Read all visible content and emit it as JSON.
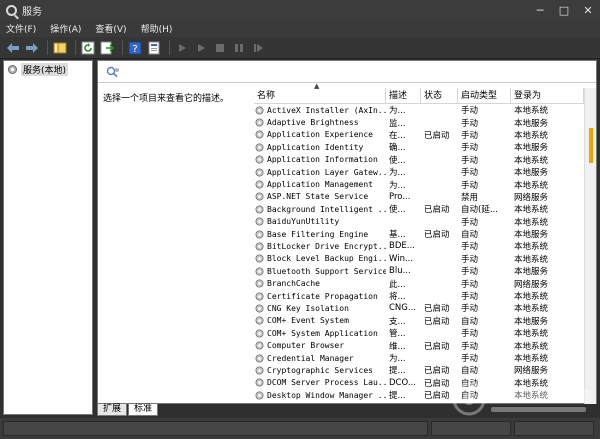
{
  "window": {
    "title": "服务",
    "minimize": "─",
    "maximize": "□",
    "close": "✕"
  },
  "menu": [
    "文件(F)",
    "操作(A)",
    "查看(V)",
    "帮助(H)"
  ],
  "tree": {
    "root_label": "服务(本地)"
  },
  "pane": {
    "description_prompt": "选择一个项目来查看它的描述。"
  },
  "columns": {
    "name": "名称",
    "desc": "描述",
    "status": "状态",
    "start": "启动类型",
    "logon": "登录为"
  },
  "services": [
    {
      "name": "ActiveX Installer (AxIn...",
      "desc": "为...",
      "status": "",
      "start": "手动",
      "logon": "本地系统"
    },
    {
      "name": "Adaptive Brightness",
      "desc": "监...",
      "status": "",
      "start": "手动",
      "logon": "本地服务"
    },
    {
      "name": "Application Experience",
      "desc": "在...",
      "status": "已启动",
      "start": "手动",
      "logon": "本地系统"
    },
    {
      "name": "Application Identity",
      "desc": "确...",
      "status": "",
      "start": "手动",
      "logon": "本地服务"
    },
    {
      "name": "Application Information",
      "desc": "使...",
      "status": "",
      "start": "手动",
      "logon": "本地系统"
    },
    {
      "name": "Application Layer Gatew...",
      "desc": "为...",
      "status": "",
      "start": "手动",
      "logon": "本地服务"
    },
    {
      "name": "Application Management",
      "desc": "为...",
      "status": "",
      "start": "手动",
      "logon": "本地系统"
    },
    {
      "name": "ASP.NET State Service",
      "desc": "Pro...",
      "status": "",
      "start": "禁用",
      "logon": "网络服务"
    },
    {
      "name": "Background Intelligent ...",
      "desc": "使...",
      "status": "已启动",
      "start": "自动(延...",
      "logon": "本地系统"
    },
    {
      "name": "BaiduYunUtility",
      "desc": "",
      "status": "",
      "start": "手动",
      "logon": "本地系统"
    },
    {
      "name": "Base Filtering Engine",
      "desc": "基...",
      "status": "已启动",
      "start": "自动",
      "logon": "本地服务"
    },
    {
      "name": "BitLocker Drive Encrypt...",
      "desc": "BDE...",
      "status": "",
      "start": "手动",
      "logon": "本地系统"
    },
    {
      "name": "Block Level Backup Engi...",
      "desc": "Win...",
      "status": "",
      "start": "手动",
      "logon": "本地系统"
    },
    {
      "name": "Bluetooth Support Service",
      "desc": "Blu...",
      "status": "",
      "start": "手动",
      "logon": "本地服务"
    },
    {
      "name": "BranchCache",
      "desc": "此...",
      "status": "",
      "start": "手动",
      "logon": "网络服务"
    },
    {
      "name": "Certificate Propagation",
      "desc": "将...",
      "status": "",
      "start": "手动",
      "logon": "本地系统"
    },
    {
      "name": "CNG Key Isolation",
      "desc": "CNG...",
      "status": "已启动",
      "start": "手动",
      "logon": "本地系统"
    },
    {
      "name": "COM+ Event System",
      "desc": "支...",
      "status": "已启动",
      "start": "自动",
      "logon": "本地服务"
    },
    {
      "name": "COM+ System Application",
      "desc": "管...",
      "status": "",
      "start": "手动",
      "logon": "本地系统"
    },
    {
      "name": "Computer Browser",
      "desc": "维...",
      "status": "已启动",
      "start": "手动",
      "logon": "本地系统"
    },
    {
      "name": "Credential Manager",
      "desc": "为...",
      "status": "",
      "start": "手动",
      "logon": "本地系统"
    },
    {
      "name": "Cryptographic Services",
      "desc": "提...",
      "status": "已启动",
      "start": "自动",
      "logon": "网络服务"
    },
    {
      "name": "DCOM Server Process Lau...",
      "desc": "DCO...",
      "status": "已启动",
      "start": "自动",
      "logon": "本地系统"
    },
    {
      "name": "Desktop Window Manager ...",
      "desc": "提...",
      "status": "已启动",
      "start": "自动",
      "logon": "本地系统"
    }
  ],
  "tabs": [
    "扩展",
    "标准"
  ],
  "colors": {
    "accent": "#e8a800",
    "chrome": "#3a3a3a"
  }
}
